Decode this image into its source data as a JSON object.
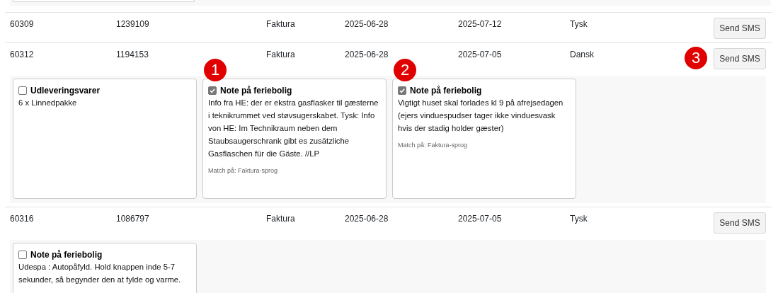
{
  "rows": [
    {
      "cells": [
        "60309",
        "1239109",
        "Faktura",
        "2025-06-28",
        "2025-07-12",
        "Tysk"
      ],
      "button": "Send SMS",
      "cards": []
    },
    {
      "cells": [
        "60312",
        "1194153",
        "Faktura",
        "2025-06-28",
        "2025-07-05",
        "Dansk"
      ],
      "button": "Send SMS",
      "marker": "3",
      "cards": [
        {
          "checked": false,
          "title": "Udleveringsvarer",
          "body": "6 x Linnedpakke"
        },
        {
          "checked": true,
          "title": "Note på feriebolig",
          "body": "Info fra HE: der er ekstra gasflasker til gæsterne i teknikrummet ved støvsugerskabet. Tysk: Info von HE: Im Technikraum neben dem Staubsaugerschrank gibt es zusätzliche Gasflaschen für die Gäste. //LP",
          "match": "Match på: Faktura-sprog",
          "marker": "1"
        },
        {
          "checked": true,
          "title": "Note på feriebolig",
          "body": "Vigtigt huset skal forlades kl 9 på afrejsedagen (ejers vinduespudser tager ikke vinduesvask hvis der stadig holder gæster)",
          "match": "Match på: Faktura-sprog",
          "marker": "2"
        }
      ]
    },
    {
      "cells": [
        "60316",
        "1086797",
        "Faktura",
        "2025-06-28",
        "2025-07-05",
        "Tysk"
      ],
      "button": "Send SMS",
      "cards": [
        {
          "checked": false,
          "title": "Note på feriebolig",
          "body": "Udespa : Autopåfyld. Hold knappen inde 5-7 sekunder, så begynder den at fylde og varme."
        }
      ]
    }
  ]
}
